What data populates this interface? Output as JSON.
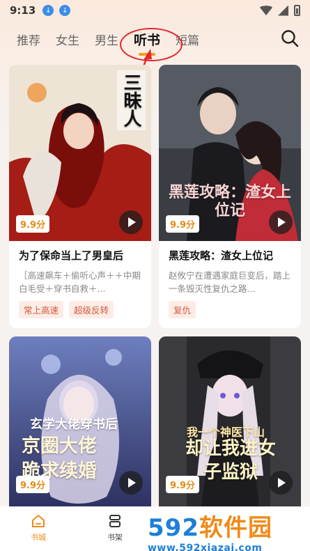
{
  "status_bar": {
    "time": "9:13"
  },
  "tabs": [
    {
      "label": "推荐"
    },
    {
      "label": "女生"
    },
    {
      "label": "男生"
    },
    {
      "label": "听书"
    },
    {
      "label": "短篇"
    }
  ],
  "active_tab": "听书",
  "books": [
    {
      "cover_text": "三昧人",
      "score": "9.9分",
      "title": "为了保命当上了男皇后",
      "description": "［高速飙车＋偷听心声＋＋中期白毛受＋穿书自救＋...",
      "tags": [
        "常上高速",
        "超级反转"
      ]
    },
    {
      "cover_text": "黑莲攻略：渣女上位记",
      "score": "9.9分",
      "title": "黑莲攻略：渣女上位记",
      "description": "赵攸宁在遭遇家庭巨变后，踏上一条毁灭性复仇之路...",
      "tags": [
        "复仇"
      ]
    },
    {
      "cover_text_small": "玄学大佬穿书后",
      "cover_text": "京圈大佬跪求续婚",
      "score": "9.9分"
    },
    {
      "cover_text_small": "我一个神医下山",
      "cover_text": "却让我进女子监狱",
      "score": "9.9分"
    }
  ],
  "bottom_nav": [
    {
      "label": "书城",
      "icon": "home-icon"
    },
    {
      "label": "书架",
      "icon": "bookshelf-icon"
    }
  ],
  "watermark": {
    "brand": "592软件园",
    "url": "www.592xiazai.com"
  },
  "colors": {
    "accent": "#f59a1e",
    "tag_text": "#d3593b",
    "annotation": "#e4262a"
  }
}
